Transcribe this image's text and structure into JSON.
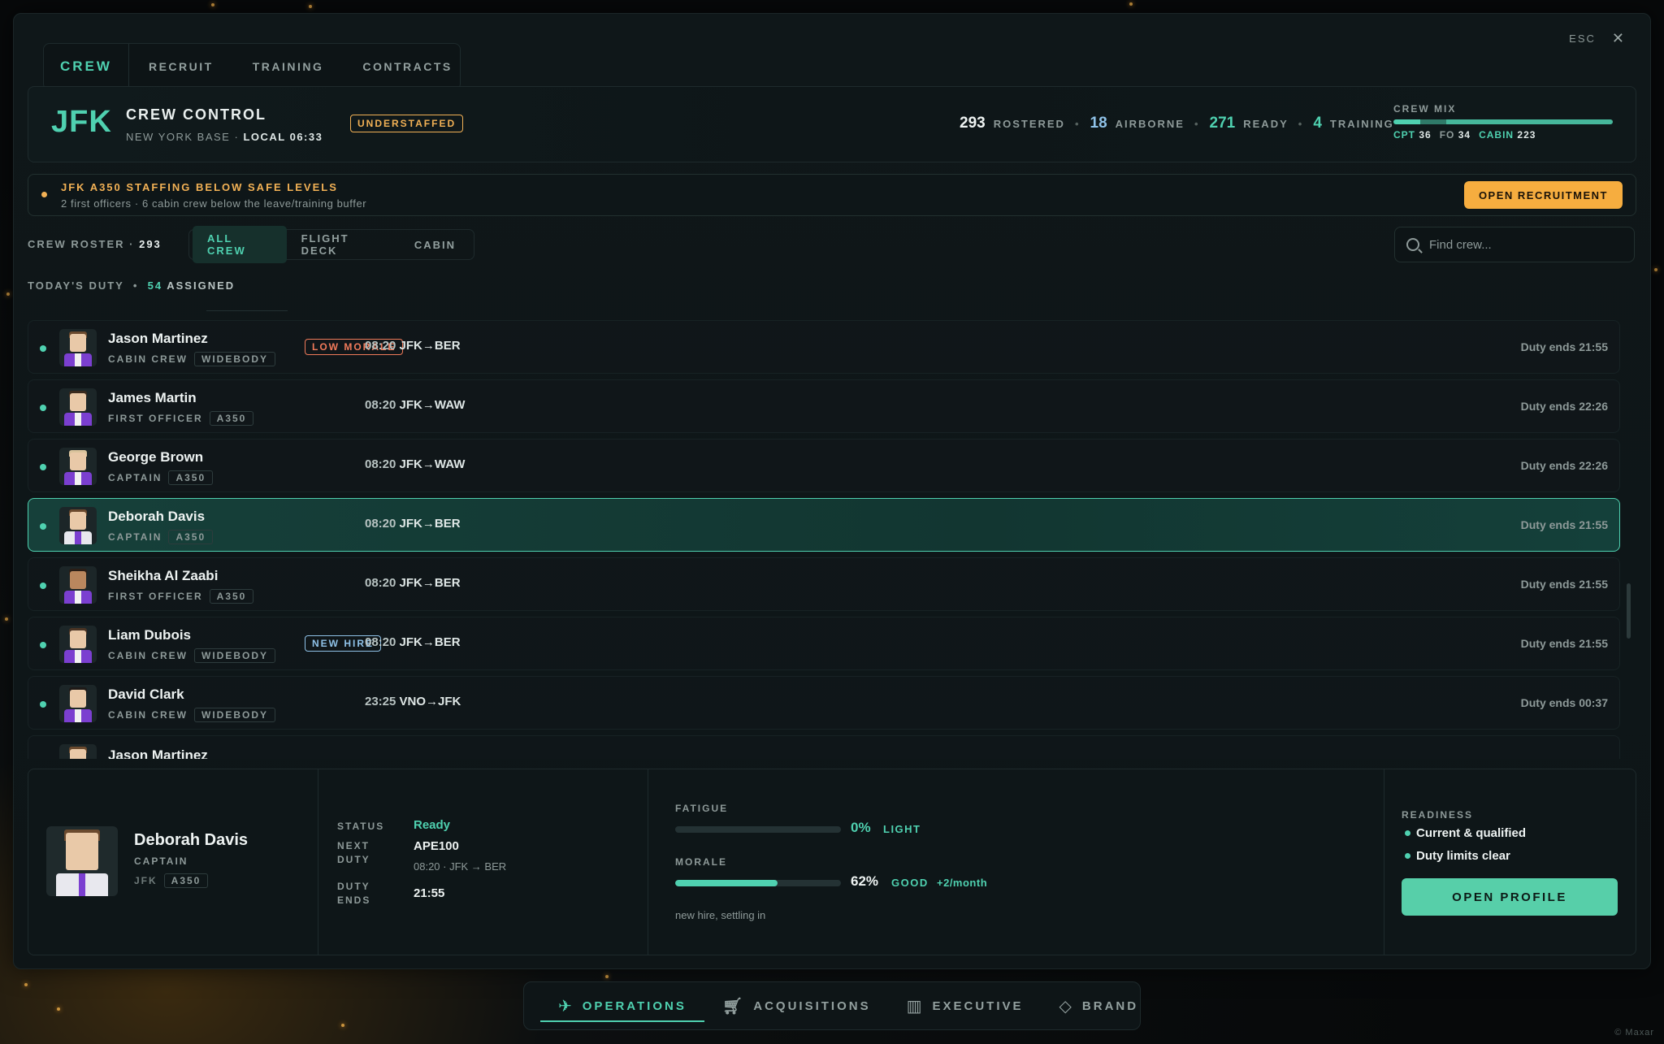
{
  "window": {
    "esc_label": "ESC",
    "close_glyph": "✕"
  },
  "top_tabs": [
    "CREW",
    "RECRUIT",
    "TRAINING",
    "CONTRACTS"
  ],
  "header": {
    "iata": "JFK",
    "title": "CREW CONTROL",
    "base": "NEW YORK BASE",
    "sep": "·",
    "local_time": "LOCAL 06:33",
    "status_badge": "UNDERSTAFFED",
    "stats": {
      "rostered": "293",
      "rostered_label": "ROSTERED",
      "airborne": "18",
      "airborne_label": "AIRBORNE",
      "ready": "271",
      "ready_label": "READY",
      "training": "4",
      "training_label": "TRAINING",
      "dot": "•"
    },
    "crew_mix": {
      "title": "CREW MIX",
      "cpt_label": "CPT",
      "cpt": "36",
      "fo_label": "FO",
      "fo": "34",
      "cabin_label": "CABIN",
      "cabin": "223",
      "shares": [
        0.123,
        0.116,
        0.761
      ]
    }
  },
  "alert": {
    "title": "JFK A350 STAFFING BELOW SAFE LEVELS",
    "subtitle": "2 first officers · 6 cabin crew below the leave/training buffer",
    "button": "OPEN RECRUITMENT"
  },
  "roster": {
    "label": "CREW ROSTER",
    "sep": "·",
    "count": "293",
    "filters": [
      "ALL CREW",
      "FLIGHT DECK",
      "CABIN"
    ],
    "search_placeholder": "Find crew..."
  },
  "duty": {
    "label": "TODAY'S DUTY",
    "dot": "•",
    "count": "54",
    "assigned": "ASSIGNED"
  },
  "rows": [
    {
      "name": "Jason Martinez",
      "role": "CABIN CREW",
      "chip": "WIDEBODY",
      "tag": "LOW MORALE",
      "time": "08:20",
      "route": "JFK→BER",
      "ends": "Duty ends 21:55"
    },
    {
      "name": "James Martin",
      "role": "FIRST OFFICER",
      "chip": "A350",
      "tag": "",
      "time": "08:20",
      "route": "JFK→WAW",
      "ends": "Duty ends 22:26"
    },
    {
      "name": "George Brown",
      "role": "CAPTAIN",
      "chip": "A350",
      "tag": "",
      "time": "08:20",
      "route": "JFK→WAW",
      "ends": "Duty ends 22:26"
    },
    {
      "name": "Deborah Davis",
      "role": "CAPTAIN",
      "chip": "A350",
      "tag": "",
      "time": "08:20",
      "route": "JFK→BER",
      "ends": "Duty ends 21:55"
    },
    {
      "name": "Sheikha Al Zaabi",
      "role": "FIRST OFFICER",
      "chip": "A350",
      "tag": "",
      "time": "08:20",
      "route": "JFK→BER",
      "ends": "Duty ends 21:55"
    },
    {
      "name": "Liam Dubois",
      "role": "CABIN CREW",
      "chip": "WIDEBODY",
      "tag": "NEW HIRE",
      "time": "08:20",
      "route": "JFK→BER",
      "ends": "Duty ends 21:55"
    },
    {
      "name": "David Clark",
      "role": "CABIN CREW",
      "chip": "WIDEBODY",
      "tag": "",
      "time": "23:25",
      "route": "VNO→JFK",
      "ends": "Duty ends 00:37"
    },
    {
      "name": "Jason Martinez",
      "role": "",
      "chip": "",
      "tag": "",
      "time": "",
      "route": "",
      "ends": ""
    }
  ],
  "detail": {
    "name": "Deborah Davis",
    "role": "CAPTAIN",
    "base": "JFK",
    "chip": "A350",
    "status_label": "STATUS",
    "status": "Ready",
    "next_duty_label_1": "NEXT",
    "next_duty_label_2": "DUTY",
    "next_duty": "APE100",
    "next_duty_sub": "08:20 · JFK → BER",
    "duty_ends_label_1": "DUTY",
    "duty_ends_label_2": "ENDS",
    "duty_ends": "21:55",
    "fatigue_label": "FATIGUE",
    "fatigue_pct": "0%",
    "fatigue_value": 0,
    "fatigue_tag": "LIGHT",
    "morale_label": "MORALE",
    "morale_pct": "62%",
    "morale_value": 0.62,
    "morale_tag": "GOOD",
    "morale_trend": "+2/month",
    "note": "new hire, settling in",
    "readiness_label": "READINESS",
    "readiness": [
      "Current & qualified",
      "Duty limits clear"
    ],
    "button": "OPEN PROFILE"
  },
  "bottom_nav": [
    {
      "label": "OPERATIONS",
      "icon": "plane-icon"
    },
    {
      "label": "ACQUISITIONS",
      "icon": "cart-icon"
    },
    {
      "label": "EXECUTIVE",
      "icon": "building-icon"
    },
    {
      "label": "BRAND",
      "icon": "diamond-icon"
    }
  ],
  "watermark": "© Maxar",
  "colors": {
    "accent": "#4fd1b0",
    "warning": "#f2b155",
    "danger": "#f07a5a",
    "info": "#8fc2e8",
    "background": "#0e1517"
  }
}
